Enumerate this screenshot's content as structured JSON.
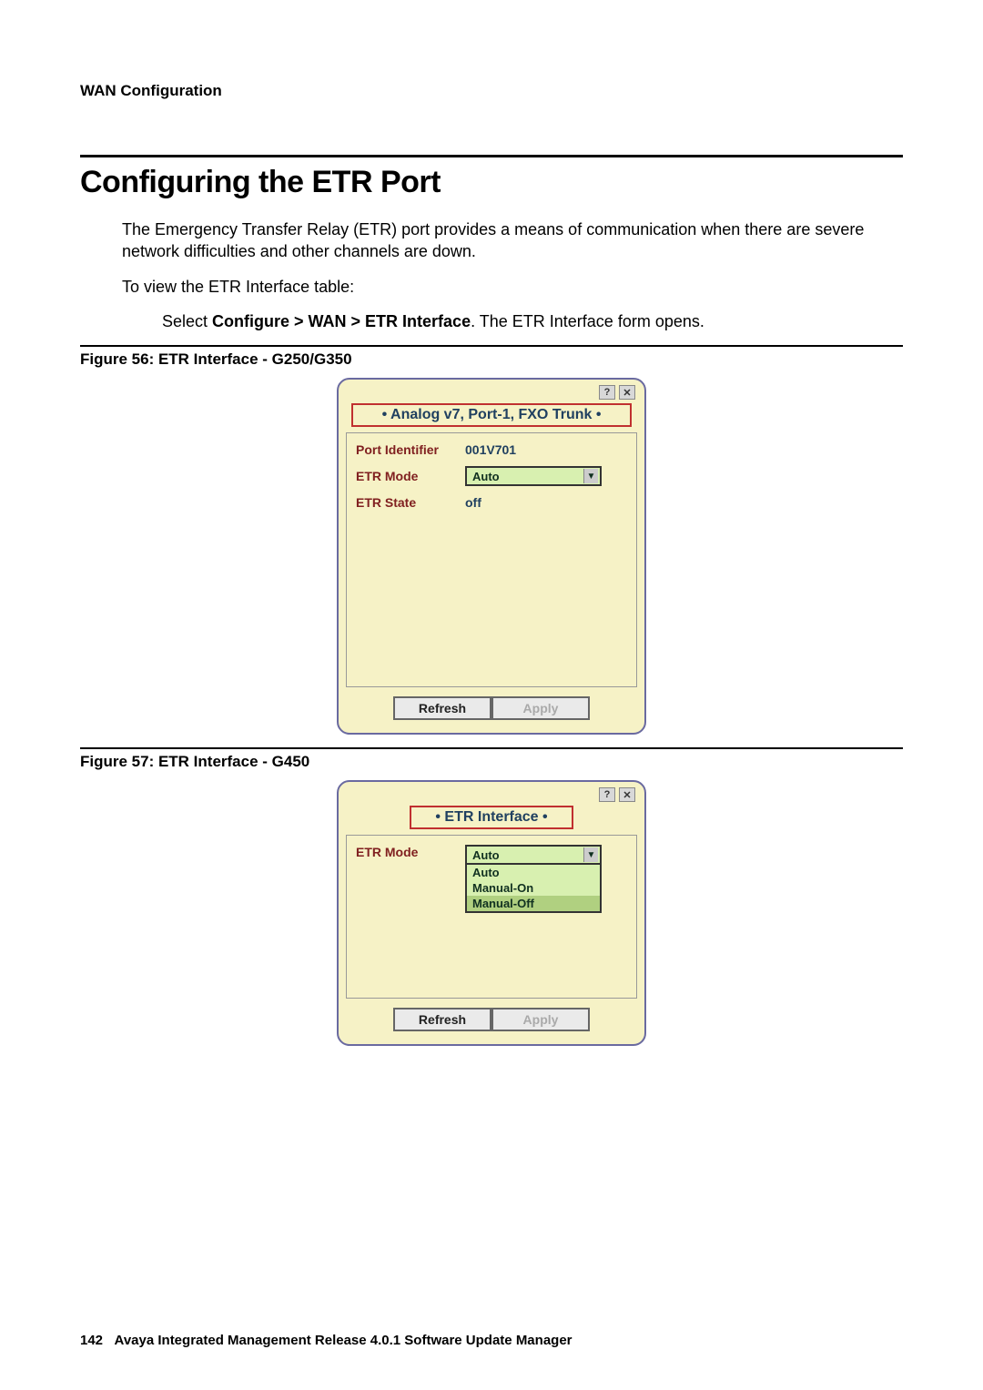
{
  "header": "WAN Configuration",
  "title": "Configuring the ETR Port",
  "para1": "The Emergency Transfer Relay (ETR) port provides a means of communication when there are severe network difficulties and other channels are down.",
  "para2": "To view the ETR Interface table:",
  "step_prefix": "Select ",
  "step_bold": "Configure > WAN > ETR Interface",
  "step_suffix": ". The ETR Interface form opens.",
  "fig56_caption": "Figure 56: ETR Interface - G250/G350",
  "fig57_caption": "Figure 57: ETR Interface - G450",
  "panel56": {
    "title": "• Analog v7, Port-1, FXO Trunk •",
    "rows": {
      "port_id_label": "Port Identifier",
      "port_id_value": "001V701",
      "etr_mode_label": "ETR Mode",
      "etr_mode_value": "Auto",
      "etr_state_label": "ETR State",
      "etr_state_value": "off"
    },
    "refresh": "Refresh",
    "apply": "Apply"
  },
  "panel57": {
    "title": "• ETR Interface •",
    "etr_mode_label": "ETR Mode",
    "etr_mode_value": "Auto",
    "options": [
      "Auto",
      "Manual-On",
      "Manual-Off"
    ],
    "refresh": "Refresh",
    "apply": "Apply"
  },
  "footer_prefix": "142",
  "footer_text": "Avaya Integrated Management Release 4.0.1 Software Update Manager"
}
